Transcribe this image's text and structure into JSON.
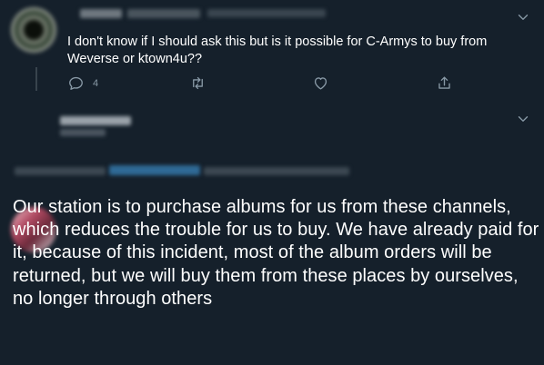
{
  "reply_tweet": {
    "text": "I don't know if I should ask this but is it possible for C-Armys to buy from Weverse or ktown4u??",
    "actions": {
      "reply_count": "4",
      "retweet_count": "",
      "like_count": ""
    }
  },
  "quoted_tweet": {
    "text": "Our station is to purchase albums for us from these channels, which reduces the trouble for us to buy. We have already paid for it,  because of this incident, most of the album orders will be returned, but we will buy them from these places by ourselves, no longer through others"
  },
  "icons": {
    "reply": "reply-icon",
    "retweet": "retweet-icon",
    "like": "like-icon",
    "share": "share-icon",
    "more": "chevron-down-icon"
  },
  "colors": {
    "background": "#15202b",
    "text": "#ffffff",
    "muted": "#8899a6",
    "divider": "#38444d"
  }
}
